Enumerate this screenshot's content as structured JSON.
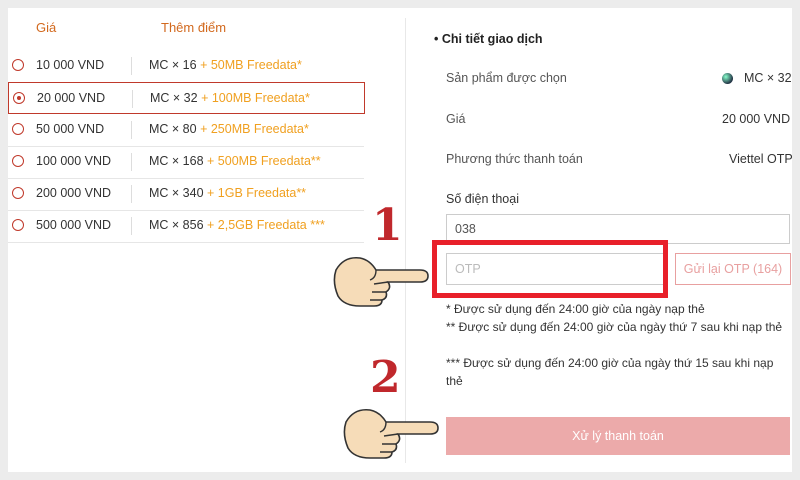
{
  "table": {
    "col_price": "Giá",
    "col_bonus": "Thêm điểm",
    "rows": [
      {
        "price": "10 000 VND",
        "mc": "MC × 16",
        "bonus": "+ 50MB Freedata*",
        "selected": false
      },
      {
        "price": "20 000 VND",
        "mc": "MC × 32",
        "bonus": "+ 100MB Freedata*",
        "selected": true
      },
      {
        "price": "50 000 VND",
        "mc": "MC × 80",
        "bonus": "+ 250MB Freedata*",
        "selected": false
      },
      {
        "price": "100 000 VND",
        "mc": "MC × 168",
        "bonus": "+ 500MB Freedata**",
        "selected": false
      },
      {
        "price": "200 000 VND",
        "mc": "MC × 340",
        "bonus": "+ 1GB Freedata**",
        "selected": false
      },
      {
        "price": "500 000 VND",
        "mc": "MC × 856",
        "bonus": "+ 2,5GB Freedata ***",
        "selected": false
      }
    ]
  },
  "details": {
    "heading": "• Chi tiết giao dịch",
    "product_label": "Sản phẩm được chọn",
    "product_value": "MC × 32",
    "price_label": "Giá",
    "price_value": "20 000 VND",
    "method_label": "Phương thức thanh toán",
    "method_value": "Viettel OTP",
    "phone_label": "Số điện thoại",
    "phone_value": "038",
    "otp_placeholder": "OTP",
    "resend_label": "Gửi lại OTP (164)",
    "note1": "*   Được sử dụng đến 24:00 giờ của ngày nạp thẻ",
    "note2": "**  Được sử dụng đến 24:00 giờ của ngày thứ 7 sau khi nạp thẻ",
    "note3": "*** Được sử dụng đến 24:00 giờ của ngày thứ 15 sau khi nạp thẻ",
    "pay_label": "Xử lý thanh toán"
  },
  "annotations": {
    "step1": "1",
    "step2": "2"
  },
  "colors": {
    "accent": "#c0392b",
    "bonus": "#f0a020",
    "highlight": "#e8202a"
  }
}
